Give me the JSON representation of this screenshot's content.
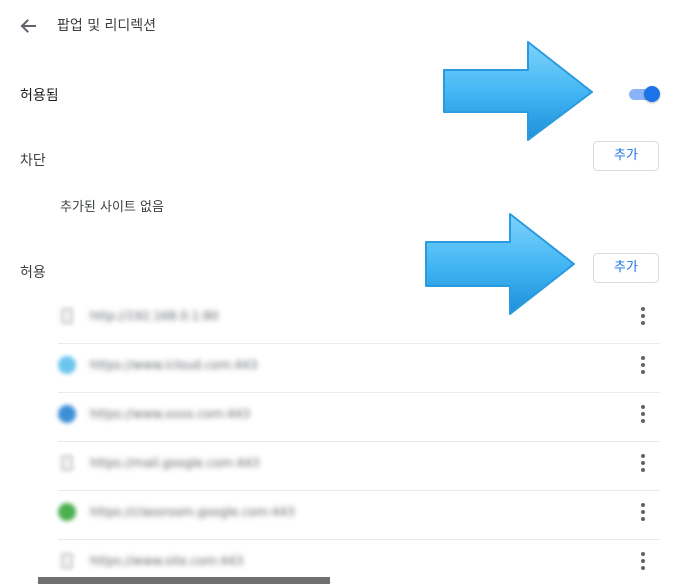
{
  "header": {
    "title": "팝업 및 리디렉션"
  },
  "allowed_setting": {
    "label": "허용됨",
    "toggle_on": true
  },
  "blocked": {
    "label": "차단",
    "add_label": "추가",
    "empty_text": "추가된 사이트 없음"
  },
  "allow": {
    "label": "허용",
    "add_label": "추가",
    "sites": [
      {
        "url": "http://192.168.0.1:80",
        "favicon": "doc"
      },
      {
        "url": "https://www.icloud.com:443",
        "favicon": "globe-lightblue"
      },
      {
        "url": "https://www.xxxx.com:443",
        "favicon": "globe-blue"
      },
      {
        "url": "https://mail.google.com:443",
        "favicon": "doc"
      },
      {
        "url": "https://classroom.google.com:443",
        "favicon": "green-leaf"
      },
      {
        "url": "https://www.site.com:443",
        "favicon": "doc"
      }
    ]
  },
  "colors": {
    "accent": "#1a73e8",
    "arrow": "#3fb4f2"
  }
}
